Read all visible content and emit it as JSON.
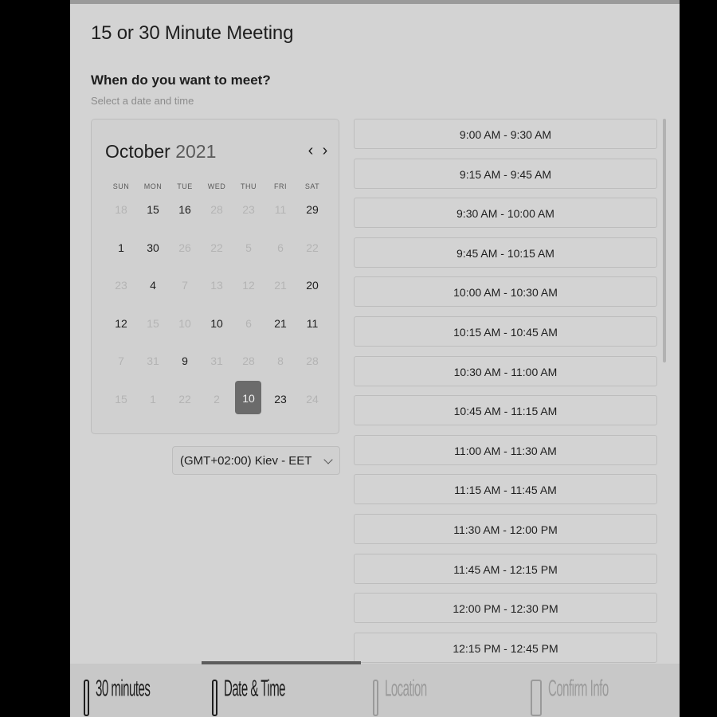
{
  "header": {
    "meeting_title": "15 or 30 Minute Meeting",
    "question": "When do you want to meet?",
    "subtitle": "Select a date and time"
  },
  "calendar": {
    "month": "October",
    "year": "2021",
    "prev_icon": "chevron-left-icon",
    "next_icon": "chevron-right-icon",
    "weekdays": [
      "SUN",
      "MON",
      "TUE",
      "WED",
      "THU",
      "FRI",
      "SAT"
    ],
    "weeks": [
      [
        {
          "d": "18",
          "s": "muted"
        },
        {
          "d": "15",
          "s": "active"
        },
        {
          "d": "16",
          "s": "active"
        },
        {
          "d": "28",
          "s": "muted"
        },
        {
          "d": "23",
          "s": "muted"
        },
        {
          "d": "11",
          "s": "muted"
        },
        {
          "d": "29",
          "s": "active"
        }
      ],
      [
        {
          "d": "1",
          "s": "active"
        },
        {
          "d": "30",
          "s": "active"
        },
        {
          "d": "26",
          "s": "muted"
        },
        {
          "d": "22",
          "s": "muted"
        },
        {
          "d": "5",
          "s": "muted"
        },
        {
          "d": "6",
          "s": "muted"
        },
        {
          "d": "22",
          "s": "muted"
        }
      ],
      [
        {
          "d": "23",
          "s": "muted"
        },
        {
          "d": "4",
          "s": "active"
        },
        {
          "d": "7",
          "s": "muted"
        },
        {
          "d": "13",
          "s": "muted"
        },
        {
          "d": "12",
          "s": "muted"
        },
        {
          "d": "21",
          "s": "muted"
        },
        {
          "d": "20",
          "s": "active"
        }
      ],
      [
        {
          "d": "12",
          "s": "active"
        },
        {
          "d": "15",
          "s": "muted"
        },
        {
          "d": "10",
          "s": "muted"
        },
        {
          "d": "10",
          "s": "active"
        },
        {
          "d": "6",
          "s": "muted"
        },
        {
          "d": "21",
          "s": "active"
        },
        {
          "d": "11",
          "s": "active"
        }
      ],
      [
        {
          "d": "7",
          "s": "muted"
        },
        {
          "d": "31",
          "s": "muted"
        },
        {
          "d": "9",
          "s": "active"
        },
        {
          "d": "31",
          "s": "muted"
        },
        {
          "d": "28",
          "s": "muted"
        },
        {
          "d": "8",
          "s": "muted"
        },
        {
          "d": "28",
          "s": "muted"
        }
      ],
      [
        {
          "d": "15",
          "s": "muted"
        },
        {
          "d": "1",
          "s": "muted"
        },
        {
          "d": "22",
          "s": "muted"
        },
        {
          "d": "2",
          "s": "muted"
        },
        {
          "d": "10",
          "s": "selected"
        },
        {
          "d": "23",
          "s": "active"
        },
        {
          "d": "24",
          "s": "muted"
        }
      ]
    ]
  },
  "timezone": {
    "value": "(GMT+02:00) Kiev - EET",
    "icon": "chevron-down-icon"
  },
  "slots": [
    "9:00 AM - 9:30 AM",
    "9:15 AM - 9:45 AM",
    "9:30 AM - 10:00 AM",
    "9:45 AM - 10:15 AM",
    "10:00 AM - 10:30 AM",
    "10:15 AM - 10:45 AM",
    "10:30 AM - 11:00 AM",
    "10:45 AM - 11:15 AM",
    "11:00 AM - 11:30 AM",
    "11:15 AM - 11:45 AM",
    "11:30 AM - 12:00 PM",
    "11:45 AM - 12:15 PM",
    "12:00 PM - 12:30 PM",
    "12:15 PM - 12:45 PM"
  ],
  "steps": [
    {
      "label": "30 minutes",
      "icon": "clock-icon",
      "state": "done"
    },
    {
      "label": "Date & Time",
      "icon": "calendar-icon",
      "state": "current"
    },
    {
      "label": "Location",
      "icon": "location-icon",
      "state": "pending"
    },
    {
      "label": "Confirm Info",
      "icon": "user-icon",
      "state": "pending"
    }
  ],
  "colors": {
    "panel_bg": "#d3d3d3",
    "selected_day": "#6b6b6b",
    "text": "#1e1e1e",
    "muted_text": "#b4b4b4"
  }
}
